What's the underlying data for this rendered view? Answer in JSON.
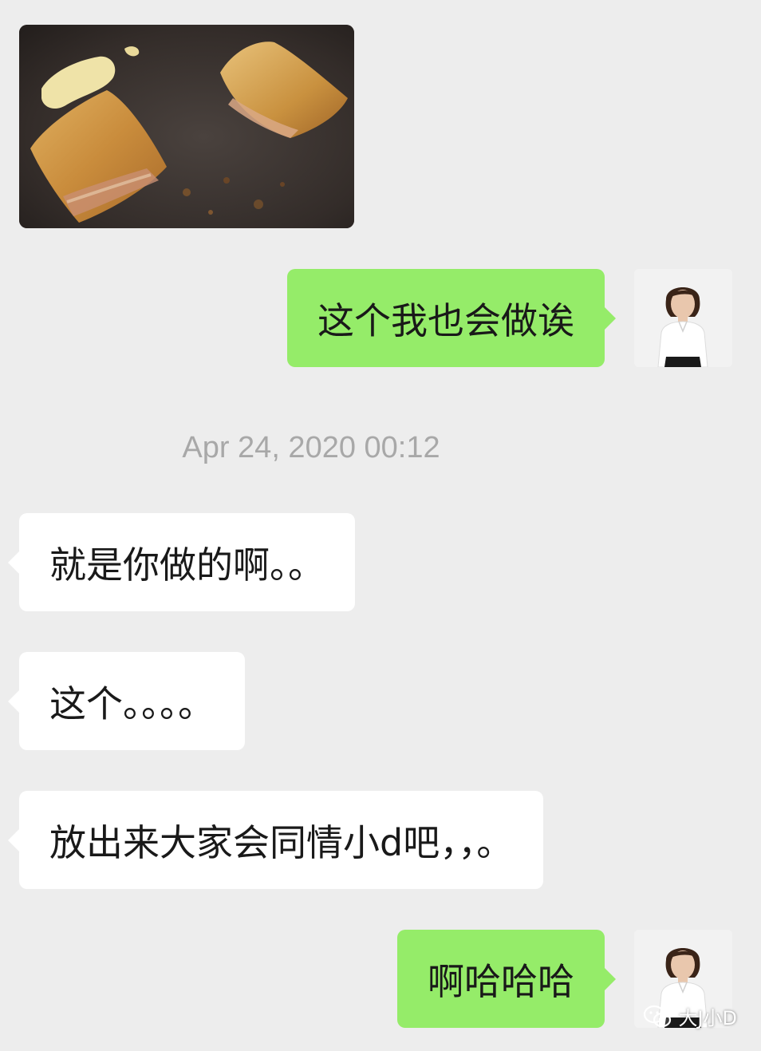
{
  "chat": {
    "image_message": {
      "icon": "fried-toast-photo"
    },
    "messages": [
      {
        "side": "out",
        "text": "这个我也会做诶"
      },
      {
        "side": "in",
        "text": "就是你做的啊。。"
      },
      {
        "side": "in",
        "text": "这个。。。。"
      },
      {
        "side": "in",
        "text": "放出来大家会同情小d吧，，。"
      },
      {
        "side": "out",
        "text": "啊哈哈哈"
      }
    ],
    "timestamp": "Apr 24, 2020 00:12"
  },
  "watermark": {
    "icon": "wechat-icon",
    "text": "大J小D"
  },
  "colors": {
    "background": "#ededed",
    "outgoing_bubble": "#95ec69",
    "incoming_bubble": "#ffffff",
    "timestamp_text": "#a8a8a8"
  }
}
